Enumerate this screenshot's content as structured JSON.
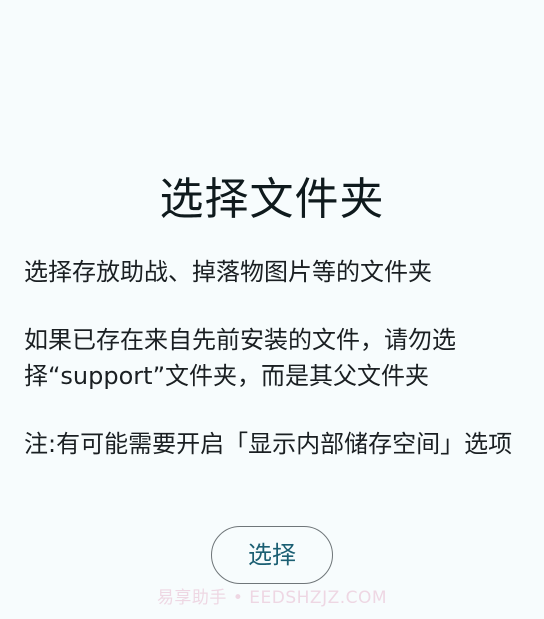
{
  "page": {
    "title": "选择文件夹",
    "paragraphs": [
      "选择存放助战、掉落物图片等的文件夹",
      "如果已存在来自先前安装的文件，请勿选择“support”文件夹，而是其父文件夹",
      "注:有可能需要开启「显示内部储存空间」选项"
    ],
    "select_button_label": "选择"
  },
  "watermark": {
    "text": "易享助手 • EEDSHZJZ.COM"
  },
  "colors": {
    "background": "#f7fcfd",
    "text": "#1a1f22",
    "button_text": "#1b5f73",
    "button_border": "#6f7679"
  }
}
